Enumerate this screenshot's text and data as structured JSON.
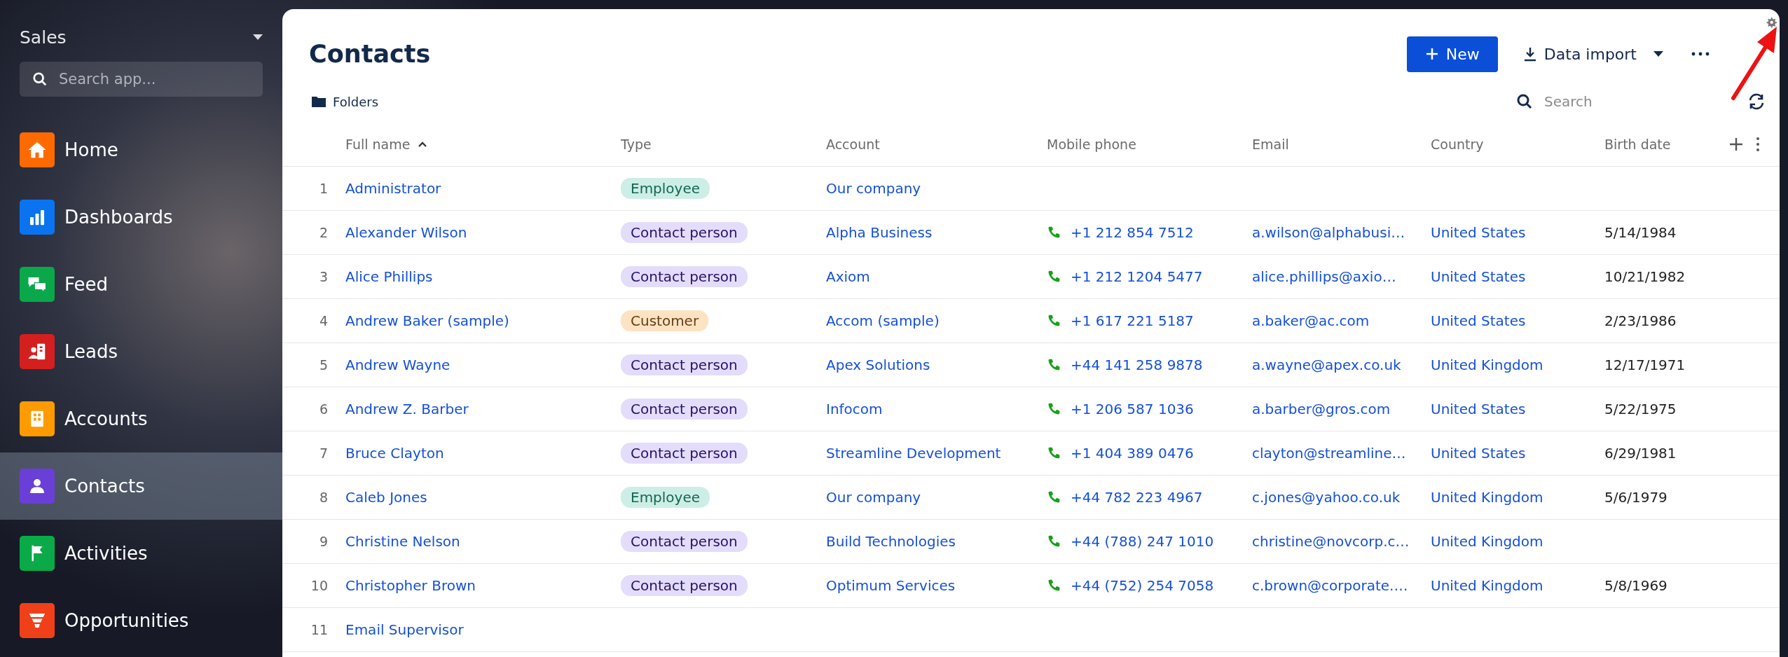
{
  "sidebar": {
    "title": "Sales",
    "search": {
      "placeholder": "Search app..."
    },
    "items": [
      {
        "label": "Home",
        "color": "#ff6a00",
        "selected": false
      },
      {
        "label": "Dashboards",
        "color": "#0a74f0",
        "selected": false
      },
      {
        "label": "Feed",
        "color": "#0aa84a",
        "selected": false
      },
      {
        "label": "Leads",
        "color": "#d41f1f",
        "selected": false
      },
      {
        "label": "Accounts",
        "color": "#ff9a00",
        "selected": false
      },
      {
        "label": "Contacts",
        "color": "#6a3fd8",
        "selected": true
      },
      {
        "label": "Activities",
        "color": "#0aaa48",
        "selected": false
      },
      {
        "label": "Opportunities",
        "color": "#f0401a",
        "selected": false
      }
    ]
  },
  "page": {
    "title": "Contacts",
    "new_button": "New",
    "import_button": "Data import",
    "folders_button": "Folders",
    "search": {
      "placeholder": "Search"
    }
  },
  "table": {
    "columns": [
      {
        "label": "Full name",
        "sorted": true
      },
      {
        "label": "Type",
        "sorted": false
      },
      {
        "label": "Account",
        "sorted": false
      },
      {
        "label": "Mobile phone",
        "sorted": false
      },
      {
        "label": "Email",
        "sorted": false
      },
      {
        "label": "Country",
        "sorted": false
      },
      {
        "label": "Birth date",
        "sorted": false
      }
    ],
    "rows": [
      {
        "number": "1",
        "name": "Administrator",
        "type": {
          "label": "Employee",
          "color": "#cdeee6"
        },
        "account": "Our company"
      },
      {
        "number": "2",
        "name": "Alexander Wilson",
        "type": {
          "label": "Contact person",
          "color": "#e4dcfb"
        },
        "account": "Alpha Business",
        "phone": "+1 212 854 7512",
        "email": "a.wilson@alphabusi…",
        "country": "United States",
        "birth_date": "5/14/1984"
      },
      {
        "number": "3",
        "name": "Alice Phillips",
        "type": {
          "label": "Contact person",
          "color": "#e4dcfb"
        },
        "account": "Axiom",
        "phone": "+1 212 1204 5477",
        "email": "alice.phillips@axio…",
        "country": "United States",
        "birth_date": "10/21/1982"
      },
      {
        "number": "4",
        "name": "Andrew Baker (sample)",
        "type": {
          "label": "Customer",
          "color": "#fde3c4"
        },
        "account": "Accom (sample)",
        "phone": "+1 617 221 5187",
        "email": "a.baker@ac.com",
        "country": "United States",
        "birth_date": "2/23/1986"
      },
      {
        "number": "5",
        "name": "Andrew Wayne",
        "type": {
          "label": "Contact person",
          "color": "#e4dcfb"
        },
        "account": "Apex Solutions",
        "phone": "+44 141 258 9878",
        "email": "a.wayne@apex.co.uk",
        "country": "United Kingdom",
        "birth_date": "12/17/1971"
      },
      {
        "number": "6",
        "name": "Andrew Z. Barber",
        "type": {
          "label": "Contact person",
          "color": "#e4dcfb"
        },
        "account": "Infocom",
        "phone": "+1 206 587 1036",
        "email": "a.barber@gros.com",
        "country": "United States",
        "birth_date": "5/22/1975"
      },
      {
        "number": "7",
        "name": "Bruce Clayton",
        "type": {
          "label": "Contact person",
          "color": "#e4dcfb"
        },
        "account": "Streamline Development",
        "phone": "+1 404 389 0476",
        "email": "clayton@streamline…",
        "country": "United States",
        "birth_date": "6/29/1981"
      },
      {
        "number": "8",
        "name": "Caleb Jones",
        "type": {
          "label": "Employee",
          "color": "#cdeee6"
        },
        "account": "Our company",
        "phone": "+44 782 223 4967",
        "email": "c.jones@yahoo.co.uk",
        "country": "United Kingdom",
        "birth_date": "5/6/1979"
      },
      {
        "number": "9",
        "name": "Christine Nelson",
        "type": {
          "label": "Contact person",
          "color": "#e4dcfb"
        },
        "account": "Build Technologies",
        "phone": "+44 (788) 247 1010",
        "email": "christine@novcorp.c…",
        "country": "United Kingdom"
      },
      {
        "number": "10",
        "name": "Christopher Brown",
        "type": {
          "label": "Contact person",
          "color": "#e4dcfb"
        },
        "account": "Optimum Services",
        "phone": "+44 (752) 254 7058",
        "email": "c.brown@corporate.…",
        "country": "United Kingdom",
        "birth_date": "5/8/1969"
      },
      {
        "number": "11",
        "name": "Email Supervisor"
      }
    ]
  }
}
